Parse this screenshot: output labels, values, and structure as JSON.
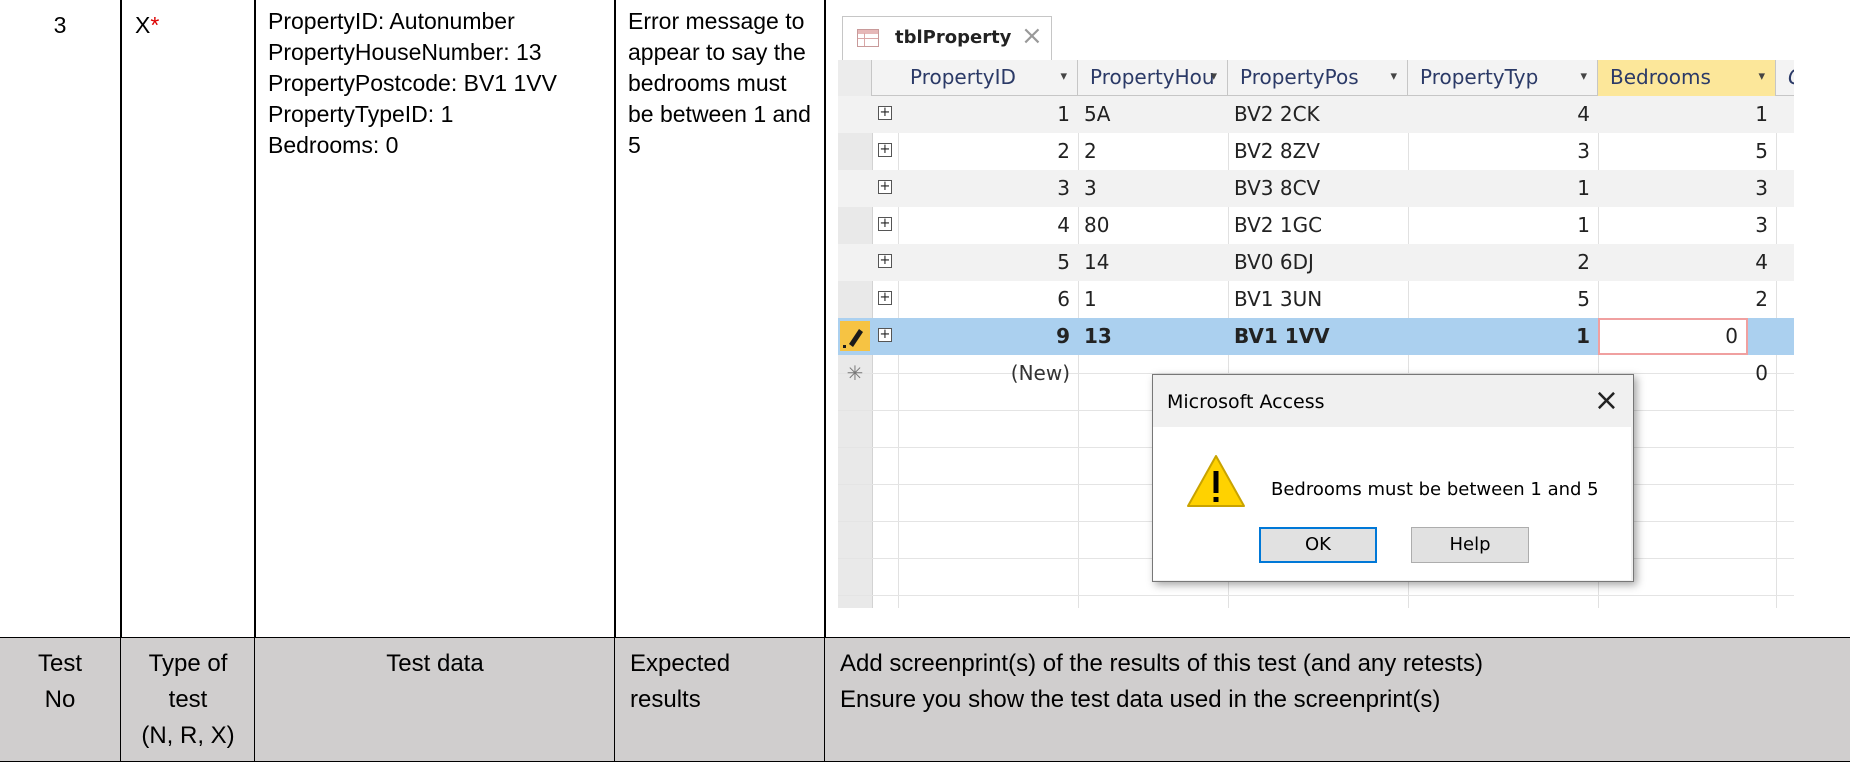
{
  "test_row": {
    "test_no": "3",
    "type_of_test": "X",
    "type_marker": "*",
    "test_data_lines": "PropertyID: Autonumber\nPropertyHouseNumber: 13\nPropertyPostcode: BV1 1VV\nPropertyTypeID: 1\nBedrooms: 0",
    "expected_results": "Error message to appear to say the bedrooms must be between 1 and 5"
  },
  "header_row": {
    "test_no": "Test\nNo",
    "type_of_test": "Type of\ntest\n(N, R, X)",
    "test_data": "Test data",
    "expected_results": "Expected\nresults",
    "screenprint_instructions": "Add screenprint(s) of the results of this test (and any retests)\nEnsure you show the test data used in the screenprint(s)"
  },
  "access": {
    "tab_label": "tblProperty",
    "columns": [
      {
        "label": "PropertyID",
        "dropdown": "▾"
      },
      {
        "label": "PropertyHou",
        "dropdown": "▾"
      },
      {
        "label": "PropertyPos",
        "dropdown": "▾"
      },
      {
        "label": "PropertyTyp",
        "dropdown": "▾"
      },
      {
        "label": "Bedrooms",
        "dropdown": "▾"
      },
      {
        "label": "Cl",
        "dropdown": ""
      }
    ],
    "rows": [
      {
        "id": "1",
        "house": "5A",
        "postcode": "BV2 2CK",
        "type": "4",
        "bedrooms": "1"
      },
      {
        "id": "2",
        "house": "2",
        "postcode": "BV2 8ZV",
        "type": "3",
        "bedrooms": "5"
      },
      {
        "id": "3",
        "house": "3",
        "postcode": "BV3 8CV",
        "type": "1",
        "bedrooms": "3"
      },
      {
        "id": "4",
        "house": "80",
        "postcode": "BV2 1GC",
        "type": "1",
        "bedrooms": "3"
      },
      {
        "id": "5",
        "house": "14",
        "postcode": "BV0 6DJ",
        "type": "2",
        "bedrooms": "4"
      },
      {
        "id": "6",
        "house": "1",
        "postcode": "BV1 3UN",
        "type": "5",
        "bedrooms": "2"
      },
      {
        "id": "9",
        "house": "13",
        "postcode": "BV1 1VV",
        "type": "1",
        "bedrooms": "0"
      }
    ],
    "expander_symbol": "+",
    "new_row": {
      "marker": "✳",
      "id": "(New)",
      "bedrooms": "0"
    },
    "editing_marker_icon": "pencil-icon",
    "dialog": {
      "title": "Microsoft Access",
      "message": "Bedrooms must be between 1 and 5",
      "ok_label": "OK",
      "help_label": "Help",
      "icon": "warning-icon"
    }
  },
  "colors": {
    "header_row_bg": "#d0cece",
    "selected_row_bg": "#abd0ef",
    "highlight_header_bg": "#fce79a",
    "error_marker": "#dd0000"
  }
}
